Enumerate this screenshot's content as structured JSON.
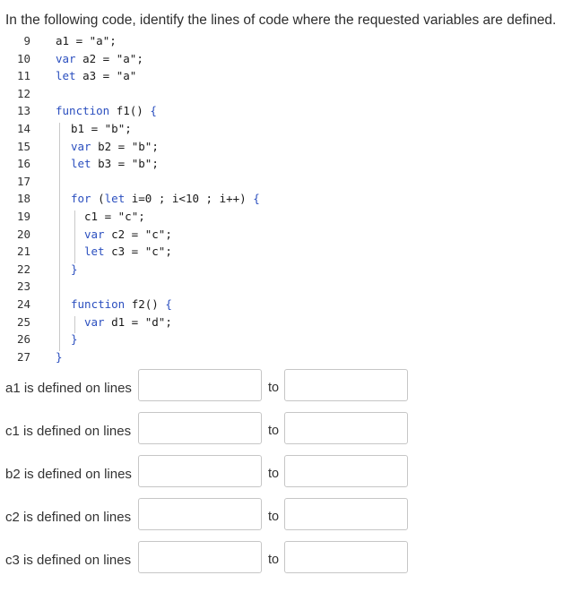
{
  "question": "In the following code, identify the lines of code where the requested variables are defined.",
  "code_lines": [
    {
      "num": "9",
      "indent": 1,
      "tokens": [
        {
          "t": "a1 = ",
          "c": "plain"
        },
        {
          "t": "\"a\"",
          "c": "str"
        },
        {
          "t": ";",
          "c": "plain"
        }
      ]
    },
    {
      "num": "10",
      "indent": 1,
      "tokens": [
        {
          "t": "var ",
          "c": "kw"
        },
        {
          "t": "a2 = ",
          "c": "plain"
        },
        {
          "t": "\"a\"",
          "c": "str"
        },
        {
          "t": ";",
          "c": "plain"
        }
      ]
    },
    {
      "num": "11",
      "indent": 1,
      "tokens": [
        {
          "t": "let ",
          "c": "kw"
        },
        {
          "t": "a3 = ",
          "c": "plain"
        },
        {
          "t": "\"a\"",
          "c": "str"
        }
      ]
    },
    {
      "num": "12",
      "indent": 1,
      "tokens": []
    },
    {
      "num": "13",
      "indent": 1,
      "tokens": [
        {
          "t": "function ",
          "c": "kw"
        },
        {
          "t": "f1() ",
          "c": "plain"
        },
        {
          "t": "{",
          "c": "brace"
        }
      ]
    },
    {
      "num": "14",
      "indent": 2,
      "tokens": [
        {
          "t": "b1 = ",
          "c": "plain"
        },
        {
          "t": "\"b\"",
          "c": "str"
        },
        {
          "t": ";",
          "c": "plain"
        }
      ]
    },
    {
      "num": "15",
      "indent": 2,
      "tokens": [
        {
          "t": "var ",
          "c": "kw"
        },
        {
          "t": "b2 = ",
          "c": "plain"
        },
        {
          "t": "\"b\"",
          "c": "str"
        },
        {
          "t": ";",
          "c": "plain"
        }
      ]
    },
    {
      "num": "16",
      "indent": 2,
      "tokens": [
        {
          "t": "let ",
          "c": "kw"
        },
        {
          "t": "b3 = ",
          "c": "plain"
        },
        {
          "t": "\"b\"",
          "c": "str"
        },
        {
          "t": ";",
          "c": "plain"
        }
      ]
    },
    {
      "num": "17",
      "indent": 2,
      "tokens": []
    },
    {
      "num": "18",
      "indent": 2,
      "tokens": [
        {
          "t": "for ",
          "c": "kw"
        },
        {
          "t": "(",
          "c": "plain"
        },
        {
          "t": "let ",
          "c": "kw"
        },
        {
          "t": "i=0 ; i<10 ; i++) ",
          "c": "plain"
        },
        {
          "t": "{",
          "c": "brace"
        }
      ]
    },
    {
      "num": "19",
      "indent": 3,
      "tokens": [
        {
          "t": "c1 = ",
          "c": "plain"
        },
        {
          "t": "\"c\"",
          "c": "str"
        },
        {
          "t": ";",
          "c": "plain"
        }
      ]
    },
    {
      "num": "20",
      "indent": 3,
      "tokens": [
        {
          "t": "var ",
          "c": "kw"
        },
        {
          "t": "c2 = ",
          "c": "plain"
        },
        {
          "t": "\"c\"",
          "c": "str"
        },
        {
          "t": ";",
          "c": "plain"
        }
      ]
    },
    {
      "num": "21",
      "indent": 3,
      "tokens": [
        {
          "t": "let ",
          "c": "kw"
        },
        {
          "t": "c3 = ",
          "c": "plain"
        },
        {
          "t": "\"c\"",
          "c": "str"
        },
        {
          "t": ";",
          "c": "plain"
        }
      ]
    },
    {
      "num": "22",
      "indent": 2,
      "tokens": [
        {
          "t": "}",
          "c": "brace"
        }
      ]
    },
    {
      "num": "23",
      "indent": 2,
      "tokens": []
    },
    {
      "num": "24",
      "indent": 2,
      "tokens": [
        {
          "t": "function ",
          "c": "kw"
        },
        {
          "t": "f2() ",
          "c": "plain"
        },
        {
          "t": "{",
          "c": "brace"
        }
      ]
    },
    {
      "num": "25",
      "indent": 3,
      "tokens": [
        {
          "t": "var ",
          "c": "kw"
        },
        {
          "t": "d1 = ",
          "c": "plain"
        },
        {
          "t": "\"d\"",
          "c": "str"
        },
        {
          "t": ";",
          "c": "plain"
        }
      ]
    },
    {
      "num": "26",
      "indent": 2,
      "tokens": [
        {
          "t": "}",
          "c": "brace"
        }
      ]
    },
    {
      "num": "27",
      "indent": 1,
      "tokens": [
        {
          "t": "}",
          "c": "brace"
        }
      ]
    }
  ],
  "answer_rows": [
    {
      "label": "a1 is defined on lines",
      "to": "to",
      "from_value": "",
      "to_value": ""
    },
    {
      "label": "c1 is defined on lines",
      "to": "to",
      "from_value": "",
      "to_value": ""
    },
    {
      "label": "b2 is defined on lines",
      "to": "to",
      "from_value": "",
      "to_value": ""
    },
    {
      "label": "c2 is defined on lines",
      "to": "to",
      "from_value": "",
      "to_value": ""
    },
    {
      "label": "c3 is defined on lines",
      "to": "to",
      "from_value": "",
      "to_value": ""
    }
  ]
}
